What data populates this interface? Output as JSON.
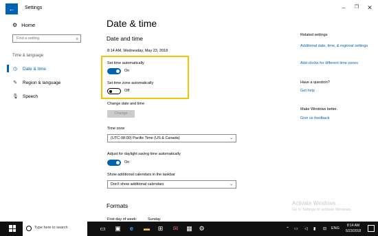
{
  "window": {
    "title": "Settings",
    "back_icon": "←",
    "minimize_icon": "–",
    "maximize_icon": "❐",
    "close_icon": "✕"
  },
  "sidebar": {
    "home_label": "Home",
    "search_placeholder": "Find a setting",
    "section_label": "Time & language",
    "items": [
      {
        "label": "Date & time",
        "active": true
      },
      {
        "label": "Region & language",
        "active": false
      },
      {
        "label": "Speech",
        "active": false
      }
    ]
  },
  "main": {
    "page_title": "Date & time",
    "section_title": "Date and time",
    "current_datetime": "8:14 AM, Wednesday, May 23, 2018",
    "set_time_auto": {
      "label": "Set time automatically",
      "state": "On",
      "on": true
    },
    "set_tz_auto": {
      "label": "Set time zone automatically",
      "state": "Off",
      "on": false
    },
    "change_date": {
      "label": "Change date and time",
      "button": "Change"
    },
    "time_zone": {
      "label": "Time zone",
      "value": "(UTC-08:00) Pacific Time (US & Canada)"
    },
    "dst": {
      "label": "Adjust for daylight saving time automatically",
      "state": "On",
      "on": true
    },
    "calendars": {
      "label": "Show additional calendars in the taskbar",
      "value": "Don't show additional calendars"
    },
    "formats_title": "Formats",
    "first_day_label": "First day of week:",
    "first_day_value": "Sunday"
  },
  "right": {
    "related_heading": "Related settings",
    "related_links": [
      "Additional date, time, & regional settings",
      "Add clocks for different time zones"
    ],
    "question_heading": "Have a question?",
    "help_link": "Get help",
    "better_heading": "Make Windows better.",
    "feedback_link": "Give us feedback"
  },
  "watermark": {
    "line1": "Activate Windows",
    "line2": "Go to Settings to activate Windows."
  },
  "taskbar": {
    "search_placeholder": "Type here to search",
    "language": "ENG",
    "time": "8:14 AM",
    "date": "5/23/2018"
  },
  "colors": {
    "accent": "#0063b1",
    "highlight_border": "#f4c400",
    "taskbar": "#101010"
  }
}
